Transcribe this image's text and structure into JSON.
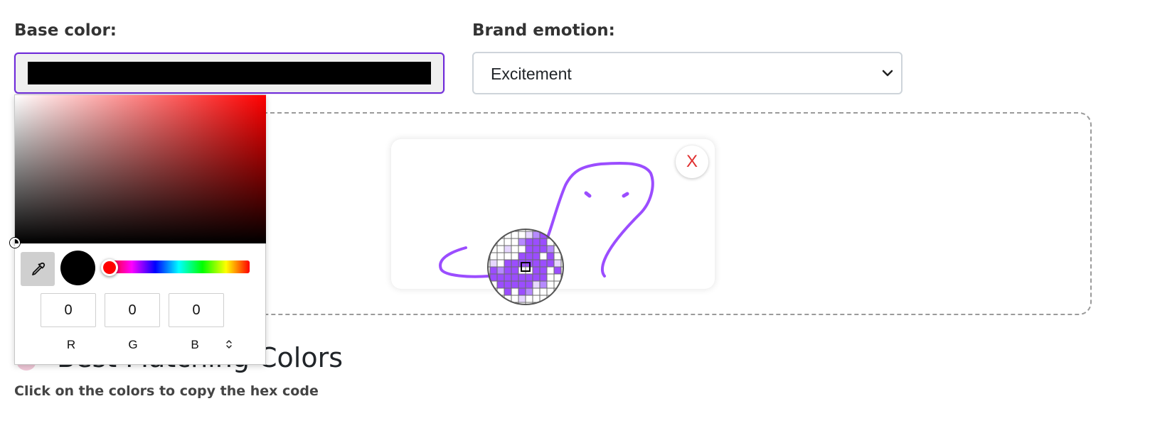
{
  "base_color": {
    "label": "Base color:",
    "value_color": "#000000"
  },
  "brand_emotion": {
    "label": "Brand emotion:",
    "selected": "Excitement"
  },
  "drawing": {
    "close_label": "X",
    "stroke_color": "#9b4dff"
  },
  "picker": {
    "hue_color": "#ff0000",
    "channels": [
      {
        "label": "R",
        "value": "0"
      },
      {
        "label": "G",
        "value": "0"
      },
      {
        "label": "B",
        "value": "0"
      }
    ],
    "icons": [
      "eyedropper-icon",
      "chevron-updown-icon"
    ]
  },
  "results": {
    "title": "Best Matching Colors",
    "hint": "Click on the colors to copy the hex code",
    "icon": "palette-icon"
  },
  "colors": {
    "accent": "#6f2bd9",
    "close": "#e02f2f"
  }
}
